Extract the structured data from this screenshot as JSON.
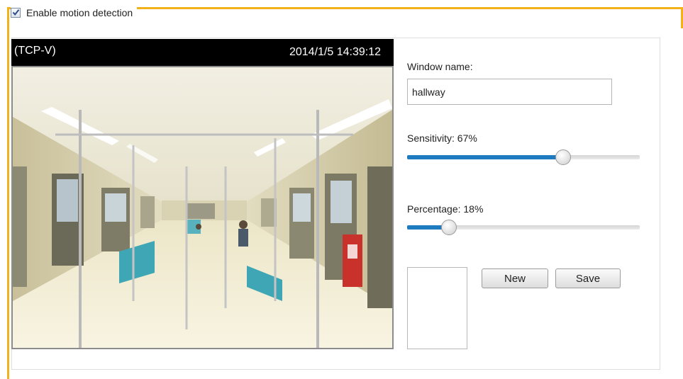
{
  "motion": {
    "enable_label": "Enable motion detection",
    "enabled": true
  },
  "video": {
    "stream_label": "(TCP-V)",
    "timestamp": "2014/1/5 14:39:12"
  },
  "window_name": {
    "label": "Window name:",
    "value": "hallway"
  },
  "sensitivity": {
    "label": "Sensitivity: 67%",
    "value_percent": 67
  },
  "percentage": {
    "label": "Percentage: 18%",
    "value_percent": 18
  },
  "buttons": {
    "new_label": "New",
    "save_label": "Save"
  },
  "colors": {
    "accent_frame": "#f2b019",
    "slider_fill": "#1e7bc0"
  }
}
